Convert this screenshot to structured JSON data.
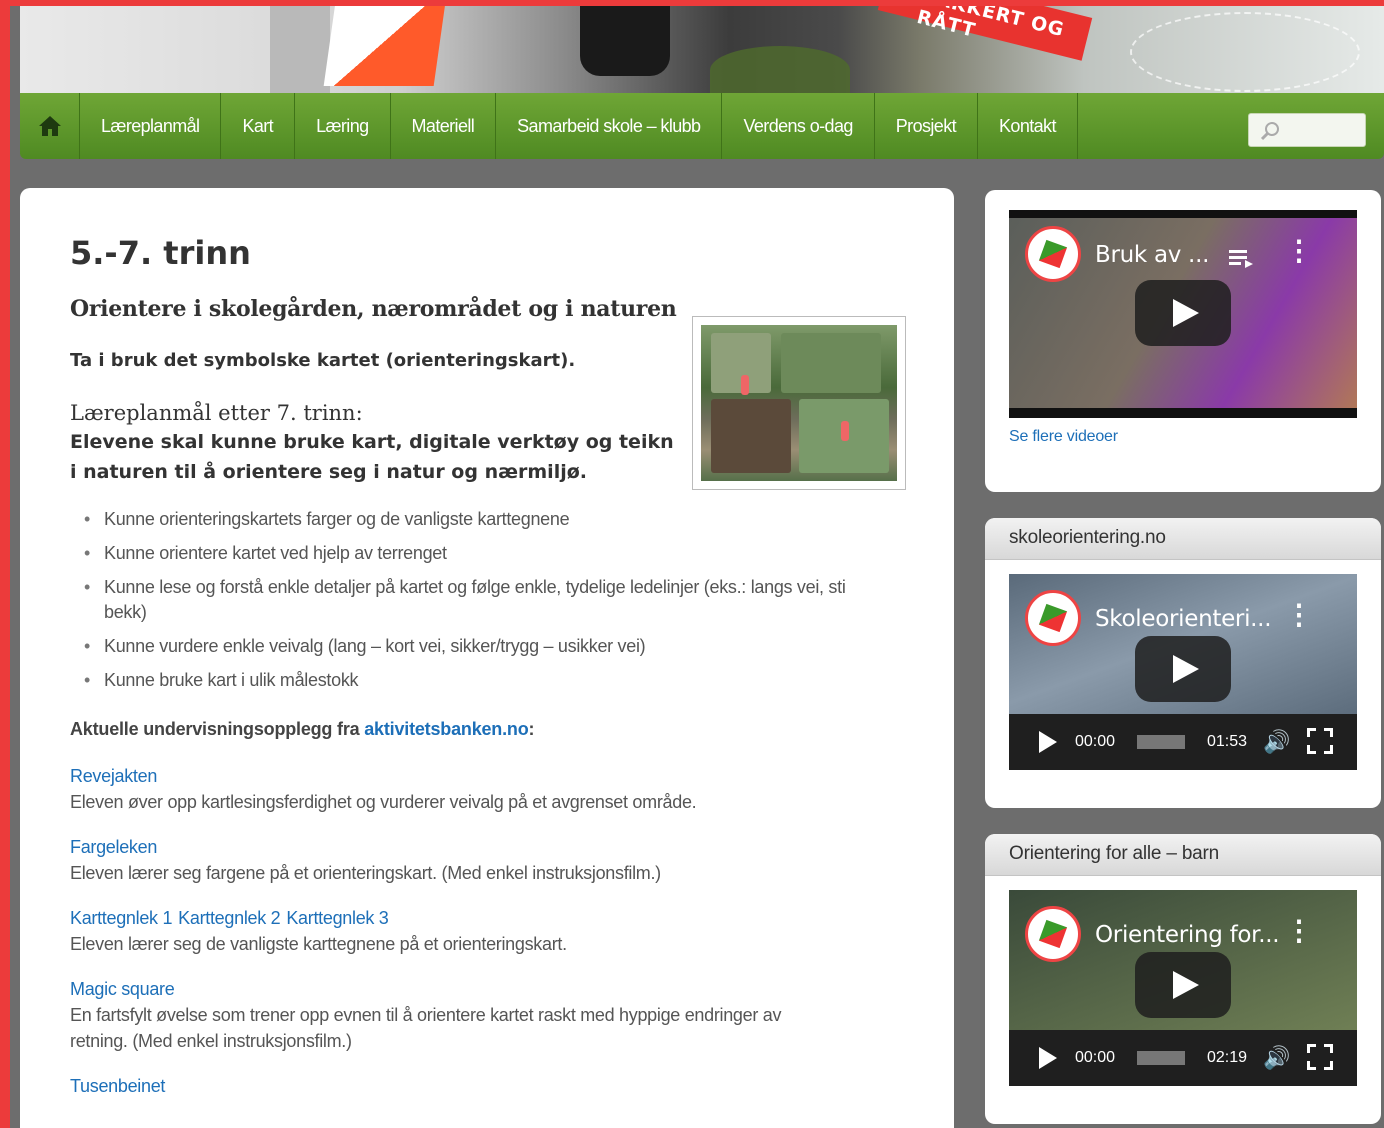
{
  "banner": {
    "ribbon_text": "VAKKERT OG RÅTT"
  },
  "nav": {
    "items": [
      "Læreplanmål",
      "Kart",
      "Læring",
      "Materiell",
      "Samarbeid skole – klubb",
      "Verdens o-dag",
      "Prosjekt",
      "Kontakt"
    ],
    "search_placeholder": ""
  },
  "content": {
    "title": "5.-7. trinn",
    "subtitle": "Orientere i skolegården, nærområdet og i naturen",
    "lead": "Ta i bruk det symbolske kartet (orienteringskart).",
    "goal_title": "Læreplanmål etter 7. trinn:",
    "goal_text": "Elevene skal kunne bruke kart, digitale verktøy og teikn i naturen til å orientere seg i natur og nærmiljø.",
    "bullets": [
      "Kunne orienteringskartets farger og de vanligste karttegnene",
      "Kunne orientere kartet ved hjelp av terrenget",
      "Kunne lese og forstå enkle detaljer på kartet og følge enkle, tydelige ledelinjer (eks.: langs vei, sti bekk)",
      "Kunne vurdere enkle veivalg (lang – kort vei, sikker/trygg – usikker vei)",
      "Kunne bruke kart i ulik målestokk"
    ],
    "aktuell_prefix": "Aktuelle undervisningsopplegg fra ",
    "aktuell_link": "aktivitetsbanken.no",
    "aktuell_suffix": ":",
    "resources": [
      {
        "links": [
          "Revejakten"
        ],
        "desc": "Eleven øver opp kartlesingsferdighet og vurderer veivalg på et avgrenset område."
      },
      {
        "links": [
          "Fargeleken"
        ],
        "desc": "Eleven lærer seg fargene på et orienteringskart. (Med enkel instruksjonsfilm.)"
      },
      {
        "links": [
          "Karttegnlek 1",
          "Karttegnlek 2",
          "Karttegnlek 3"
        ],
        "desc": "Eleven lærer seg de vanligste karttegnene på et orienteringskart."
      },
      {
        "links": [
          "Magic square"
        ],
        "desc": "En fartsfylt øvelse som trener opp evnen til å orientere kartet raskt med hyppige endringer av retning. (Med enkel instruksjonsfilm.)"
      },
      {
        "links": [
          "Tusenbeinet"
        ],
        "desc": ""
      }
    ]
  },
  "sidebar": {
    "video1": {
      "title": "Bruk av ...",
      "see_more": "Se flere videoer"
    },
    "widget2": {
      "heading": "skoleorientering.no",
      "video_title": "Skoleorienteri...",
      "time_current": "00:00",
      "time_total": "01:53"
    },
    "widget3": {
      "heading": "Orientering for alle – barn",
      "video_title": "Orientering for...",
      "time_current": "00:00",
      "time_total": "02:19"
    }
  },
  "colors": {
    "nav_green": "#5a962a",
    "link_blue": "#1d6fb8",
    "frame_red": "#ec3b3b",
    "page_gray": "#6d6d6d"
  },
  "icons": [
    "home-icon",
    "search-icon",
    "playlist-icon",
    "more-vert-icon",
    "play-icon",
    "volume-icon",
    "fullscreen-icon"
  ]
}
